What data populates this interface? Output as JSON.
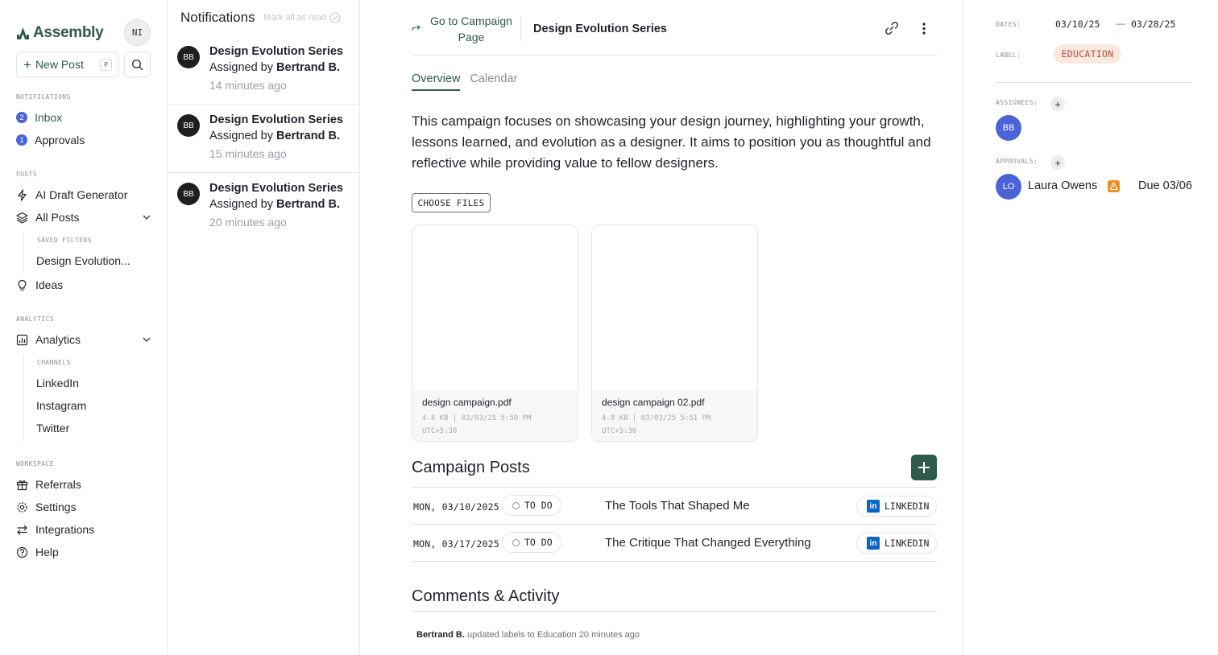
{
  "brand": {
    "name": "Assembly",
    "color": "#2f5a4b"
  },
  "user": {
    "initials": "NI"
  },
  "sidebar": {
    "new_post_label": "New Post",
    "new_post_shortcut": "P",
    "sections": {
      "notifications": "NOTIFICATIONS",
      "posts": "POSTS",
      "analytics": "ANALYTICS",
      "workspace": "WORKSPACE"
    },
    "inbox": {
      "label": "Inbox",
      "count": "2"
    },
    "approvals": {
      "label": "Approvals",
      "count": "1"
    },
    "ai_draft": "AI Draft Generator",
    "all_posts": "All Posts",
    "saved_filters_label": "SAVED FILTERS",
    "saved_filter_1": "Design Evolution...",
    "ideas": "Ideas",
    "analytics": "Analytics",
    "channels_label": "CHANNELS",
    "channels": [
      "LinkedIn",
      "Instagram",
      "Twitter"
    ],
    "referrals": "Referrals",
    "settings": "Settings",
    "integrations": "Integrations",
    "help": "Help"
  },
  "notifications": {
    "title": "Notifications",
    "mark_all": "Mark all as read",
    "items": [
      {
        "initials": "BB",
        "title": "Design Evolution Series",
        "prefix": "Assigned by ",
        "who": "Bertrand B.",
        "time": "14 minutes ago"
      },
      {
        "initials": "BB",
        "title": "Design Evolution Series",
        "prefix": "Assigned by ",
        "who": "Bertrand B.",
        "time": "15 minutes ago"
      },
      {
        "initials": "BB",
        "title": "Design Evolution Series",
        "prefix": "Assigned by ",
        "who": "Bertrand B.",
        "time": "20 minutes ago"
      }
    ]
  },
  "campaign": {
    "goto_label": "Go to Campaign Page",
    "title": "Design Evolution Series",
    "tabs": [
      "Overview",
      "Calendar"
    ],
    "description": "This campaign focuses on showcasing your design journey, highlighting your growth, lessons learned, and evolution as a designer. It aims to position you as thoughtful and reflective while providing value to fellow designers.",
    "choose_files": "CHOOSE FILES",
    "files": [
      {
        "name": "design campaign.pdf",
        "meta1": "4.8 KB | 03/03/25 5:50 PM",
        "meta2": "UTC+5:30"
      },
      {
        "name": "design campaign 02.pdf",
        "meta1": "4.8 KB | 03/03/25 5:51 PM",
        "meta2": "UTC+5:30"
      }
    ],
    "posts_title": "Campaign Posts",
    "posts": [
      {
        "date": "MON, 03/10/2025",
        "status": "TO DO",
        "title": "The Tools That Shaped Me",
        "channel": "LINKEDIN"
      },
      {
        "date": "MON, 03/17/2025",
        "status": "TO DO",
        "title": "The Critique That Changed Everything",
        "channel": "LINKEDIN"
      }
    ],
    "comments_title": "Comments & Activity",
    "activity": {
      "who": "Bertrand B.",
      "text": "updated labels to Education",
      "time": "20 minutes ago"
    }
  },
  "details": {
    "dates_label": "DATES:",
    "start_date": "03/10/25",
    "end_date": "03/28/25",
    "label_label": "LABEL:",
    "label_value": "EDUCATION",
    "assignees_label": "ASSIGNEES:",
    "assignee_initials": "BB",
    "approvals_label": "APPROVALS:",
    "approver_initials": "LO",
    "approver_name": "Laura Owens",
    "approver_due": "Due 03/06"
  },
  "colors": {
    "accent_green": "#2f5a4b",
    "badge_blue": "#4a64d8",
    "linkedin": "#0a66c2",
    "label_bg": "#fbe8df",
    "label_text": "#b3543a",
    "warning": "#f08a24"
  }
}
